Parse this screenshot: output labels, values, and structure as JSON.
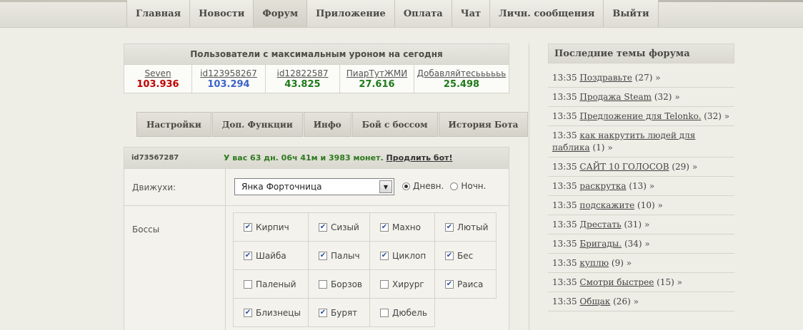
{
  "nav": [
    "Главная",
    "Новости",
    "Форум",
    "Приложение",
    "Оплата",
    "Чат",
    "Личн. сообщения",
    "Выйти"
  ],
  "top_users": {
    "title": "Пользователи с максимальным уроном на сегодня",
    "users": [
      {
        "name": "Seven",
        "score": "103.936",
        "color": "#c00000"
      },
      {
        "name": "id123958267",
        "score": "103.294",
        "color": "#3c63c9"
      },
      {
        "name": "id12822587",
        "score": "43.825",
        "color": "#1f7a1a"
      },
      {
        "name": "ПиарТутЖМИ",
        "score": "27.616",
        "color": "#1f7a1a"
      },
      {
        "name": "Добавляйтесьььььь",
        "score": "25.498",
        "color": "#1f7a1a"
      }
    ]
  },
  "subnav": [
    "Настройки",
    "Доп. Функции",
    "Инфо",
    "Бой с боссом",
    "История Бота"
  ],
  "panel": {
    "user_id": "id73567287",
    "status_text": "У вас 63 дн. 06ч 41м и 3983 монет.",
    "extend_link": "Продлить бот!",
    "moves_label": "Движухи:",
    "moves_selected": "Янка Форточница",
    "radio_day": "Дневн.",
    "radio_night": "Ночн.",
    "bosses_label": "Боссы",
    "bosses": [
      {
        "name": "Кирпич",
        "checked": true
      },
      {
        "name": "Сизый",
        "checked": true
      },
      {
        "name": "Махно",
        "checked": true
      },
      {
        "name": "Лютый",
        "checked": true
      },
      {
        "name": "Шайба",
        "checked": true
      },
      {
        "name": "Палыч",
        "checked": true
      },
      {
        "name": "Циклоп",
        "checked": true
      },
      {
        "name": "Бес",
        "checked": true
      },
      {
        "name": "Паленый",
        "checked": false
      },
      {
        "name": "Борзов",
        "checked": false
      },
      {
        "name": "Хирург",
        "checked": false
      },
      {
        "name": "Раиса",
        "checked": true
      },
      {
        "name": "Близнецы",
        "checked": true
      },
      {
        "name": "Бурят",
        "checked": true
      },
      {
        "name": "Дюбель",
        "checked": false
      }
    ]
  },
  "sidebar": {
    "title": "Последние темы форума",
    "more": "»",
    "topics": [
      {
        "time": "13:35",
        "title": "Поздравьте",
        "count": "(27)"
      },
      {
        "time": "13:35",
        "title": "Продажа Steam",
        "count": "(32)"
      },
      {
        "time": "13:35",
        "title": "Предложение для Telonko.",
        "count": "(32)"
      },
      {
        "time": "13:35",
        "title": "как накрутить людей для паблика",
        "count": "(1)"
      },
      {
        "time": "13:35",
        "title": "САЙТ 10 ГОЛОСОВ",
        "count": "(29)"
      },
      {
        "time": "13:35",
        "title": "раскрутка",
        "count": "(13)"
      },
      {
        "time": "13:35",
        "title": "подскажите",
        "count": "(10)"
      },
      {
        "time": "13:35",
        "title": "Дрестать",
        "count": "(31)"
      },
      {
        "time": "13:35",
        "title": "Бригады.",
        "count": "(34)"
      },
      {
        "time": "13:35",
        "title": "куплю",
        "count": "(9)"
      },
      {
        "time": "13:35",
        "title": "Смотри быстрее",
        "count": "(15)"
      },
      {
        "time": "13:35",
        "title": "Общак",
        "count": "(26)"
      }
    ]
  }
}
